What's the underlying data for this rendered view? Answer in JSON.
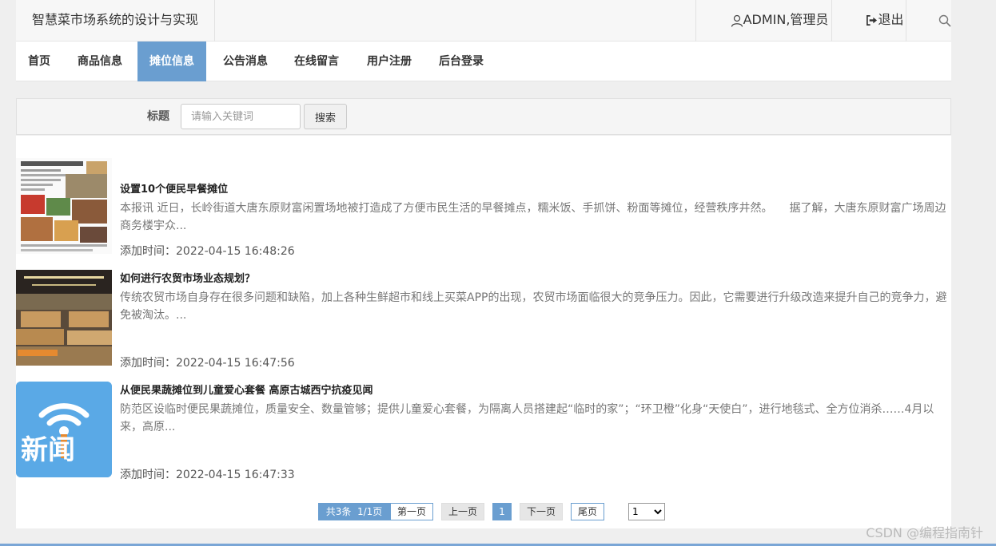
{
  "header": {
    "site_title": "智慧菜市场系统的设计与实现",
    "user_label": "ADMIN,管理员",
    "logout_label": "退出",
    "search_icon": "search-icon",
    "user_icon": "user-icon",
    "logout_icon": "sign-out-icon"
  },
  "nav": {
    "items": [
      {
        "label": "首页",
        "active": false
      },
      {
        "label": "商品信息",
        "active": false
      },
      {
        "label": "摊位信息",
        "active": true
      },
      {
        "label": "公告消息",
        "active": false
      },
      {
        "label": "在线留言",
        "active": false
      },
      {
        "label": "用户注册",
        "active": false
      },
      {
        "label": "后台登录",
        "active": false
      }
    ]
  },
  "search": {
    "label": "标题",
    "placeholder": "请输入关键词",
    "value": "",
    "button_label": "搜索"
  },
  "news": [
    {
      "title": "设置10个便民早餐摊位",
      "summary": "本报讯 近日，长岭街道大唐东原财富闲置场地被打造成了方便市民生活的早餐摊点，糯米饭、手抓饼、粉面等摊位，经营秩序井然。　　据了解，大唐东原财富广场周边商务楼宇众...",
      "time": "添加时间：2022-04-15 16:48:26"
    },
    {
      "title": "如何进行农贸市场业态规划？",
      "summary": "传统农贸市场自身存在很多问题和缺陷，加上各种生鲜超市和线上买菜APP的出现，农贸市场面临很大的竞争压力。因此，它需要进行升级改造来提升自己的竞争力，避免被淘汰。...",
      "time": "添加时间：2022-04-15 16:47:56"
    },
    {
      "title": "从便民果蔬摊位到儿童爱心套餐 高原古城西宁抗疫见闻",
      "summary": "防范区设临时便民果蔬摊位，质量安全、数量管够；提供儿童爱心套餐，为隔离人员搭建起“临时的家”；“环卫橙”化身“天使白”，进行地毯式、全方位消杀……4月以来，高原...",
      "time": "添加时间：2022-04-15 16:47:33",
      "thumb_text": "新闻"
    }
  ],
  "pagination": {
    "total": "共3条",
    "pages": "1/1页",
    "first": "第一页",
    "prev": "上一页",
    "current": "1",
    "next": "下一页",
    "last": "尾页",
    "select_value": "1"
  },
  "watermark": "CSDN @编程指南针",
  "colors": {
    "accent": "#6a9ed0",
    "topbar_bg": "#f7f7f7",
    "page_bg": "#efefef"
  }
}
